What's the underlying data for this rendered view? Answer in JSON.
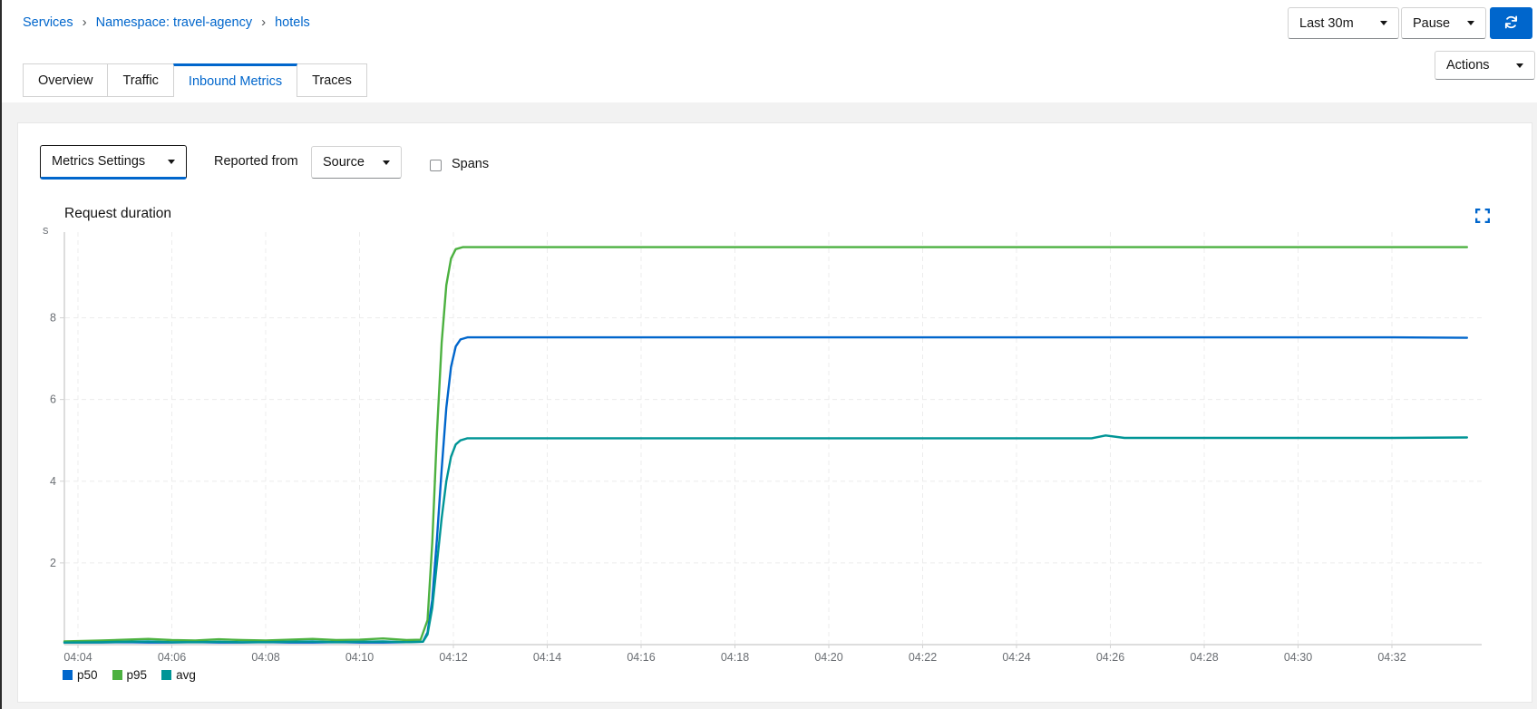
{
  "breadcrumb": {
    "items": [
      "Services",
      "Namespace: travel-agency",
      "hotels"
    ],
    "separator": "›"
  },
  "top_toolbar": {
    "duration_label": "Last 30m",
    "refresh_mode_label": "Pause",
    "refresh_icon": "sync-icon"
  },
  "actions": {
    "label": "Actions"
  },
  "tabs": [
    {
      "label": "Overview",
      "active": false
    },
    {
      "label": "Traffic",
      "active": false
    },
    {
      "label": "Inbound Metrics",
      "active": true
    },
    {
      "label": "Traces",
      "active": false
    }
  ],
  "metrics_toolbar": {
    "settings_label": "Metrics Settings",
    "reported_from_label": "Reported from",
    "reporter_label": "Source",
    "spans_label": "Spans",
    "spans_checked": false
  },
  "colors": {
    "primary": "#0066cc",
    "link": "#0066cc",
    "axis": "#d2d2d2",
    "grid": "#ececec",
    "tick_text": "#6a6e73"
  },
  "icons": {
    "expand": "expand-icon",
    "refresh": "sync-icon",
    "caret": "caret-down-icon",
    "breadcrumb_separator": "angle-right-icon"
  },
  "chart_data": {
    "type": "line",
    "title": "Request duration",
    "ylabel": "s",
    "unit": "s",
    "grid": true,
    "legend_position": "bottom",
    "xticks": [
      "04:04",
      "04:06",
      "04:08",
      "04:10",
      "04:12",
      "04:14",
      "04:16",
      "04:18",
      "04:20",
      "04:22",
      "04:24",
      "04:26",
      "04:28",
      "04:30",
      "04:32"
    ],
    "xtick_minutes": [
      4,
      6,
      8,
      10,
      12,
      14,
      16,
      18,
      20,
      22,
      24,
      26,
      28,
      30,
      32
    ],
    "yticks": [
      2,
      4,
      6,
      8
    ],
    "xlim_minutes": [
      3.71,
      33.9
    ],
    "ylim": [
      0,
      10.1
    ],
    "series": [
      {
        "name": "p50",
        "color": "#0066CC",
        "plateau_value": 7.52,
        "points": [
          [
            3.71,
            0.05
          ],
          [
            4.5,
            0.05
          ],
          [
            5,
            0.06
          ],
          [
            5.5,
            0.05
          ],
          [
            6,
            0.05
          ],
          [
            6.5,
            0.06
          ],
          [
            7,
            0.05
          ],
          [
            7.5,
            0.05
          ],
          [
            8,
            0.06
          ],
          [
            8.5,
            0.05
          ],
          [
            9,
            0.05
          ],
          [
            9.5,
            0.06
          ],
          [
            10,
            0.05
          ],
          [
            10.5,
            0.05
          ],
          [
            11,
            0.06
          ],
          [
            11.35,
            0.07
          ],
          [
            11.45,
            0.3
          ],
          [
            11.55,
            1.1
          ],
          [
            11.65,
            2.6
          ],
          [
            11.75,
            4.3
          ],
          [
            11.85,
            5.8
          ],
          [
            11.95,
            6.8
          ],
          [
            12.05,
            7.3
          ],
          [
            12.15,
            7.47
          ],
          [
            12.3,
            7.52
          ],
          [
            14,
            7.52
          ],
          [
            17,
            7.52
          ],
          [
            20,
            7.52
          ],
          [
            23,
            7.52
          ],
          [
            26,
            7.52
          ],
          [
            29,
            7.52
          ],
          [
            32,
            7.52
          ],
          [
            33.6,
            7.51
          ]
        ]
      },
      {
        "name": "p95",
        "color": "#4CB140",
        "plateau_value": 9.73,
        "points": [
          [
            3.71,
            0.08
          ],
          [
            4.5,
            0.1
          ],
          [
            5,
            0.12
          ],
          [
            5.5,
            0.14
          ],
          [
            6,
            0.11
          ],
          [
            6.5,
            0.1
          ],
          [
            7,
            0.13
          ],
          [
            7.5,
            0.11
          ],
          [
            8,
            0.1
          ],
          [
            8.5,
            0.12
          ],
          [
            9,
            0.14
          ],
          [
            9.5,
            0.11
          ],
          [
            10,
            0.12
          ],
          [
            10.5,
            0.15
          ],
          [
            11,
            0.11
          ],
          [
            11.3,
            0.12
          ],
          [
            11.45,
            0.6
          ],
          [
            11.55,
            2.5
          ],
          [
            11.65,
            5.2
          ],
          [
            11.75,
            7.4
          ],
          [
            11.85,
            8.8
          ],
          [
            11.95,
            9.45
          ],
          [
            12.05,
            9.68
          ],
          [
            12.2,
            9.73
          ],
          [
            14,
            9.73
          ],
          [
            17,
            9.73
          ],
          [
            20,
            9.73
          ],
          [
            23,
            9.73
          ],
          [
            26,
            9.73
          ],
          [
            29,
            9.73
          ],
          [
            32,
            9.73
          ],
          [
            33.6,
            9.73
          ]
        ]
      },
      {
        "name": "avg",
        "color": "#009596",
        "plateau_value": 5.05,
        "points": [
          [
            3.71,
            0.05
          ],
          [
            4.5,
            0.06
          ],
          [
            5,
            0.07
          ],
          [
            5.5,
            0.08
          ],
          [
            6,
            0.06
          ],
          [
            6.5,
            0.06
          ],
          [
            7,
            0.07
          ],
          [
            7.5,
            0.06
          ],
          [
            8,
            0.06
          ],
          [
            8.5,
            0.07
          ],
          [
            9,
            0.08
          ],
          [
            9.5,
            0.06
          ],
          [
            10,
            0.07
          ],
          [
            10.5,
            0.08
          ],
          [
            11,
            0.06
          ],
          [
            11.35,
            0.07
          ],
          [
            11.45,
            0.25
          ],
          [
            11.55,
            0.9
          ],
          [
            11.65,
            2.0
          ],
          [
            11.75,
            3.1
          ],
          [
            11.85,
            4.0
          ],
          [
            11.95,
            4.6
          ],
          [
            12.05,
            4.9
          ],
          [
            12.15,
            5.0
          ],
          [
            12.3,
            5.05
          ],
          [
            15,
            5.05
          ],
          [
            18,
            5.05
          ],
          [
            21,
            5.05
          ],
          [
            24,
            5.05
          ],
          [
            25.6,
            5.05
          ],
          [
            25.9,
            5.12
          ],
          [
            26.3,
            5.06
          ],
          [
            29,
            5.06
          ],
          [
            32,
            5.06
          ],
          [
            33.6,
            5.07
          ]
        ]
      }
    ]
  }
}
